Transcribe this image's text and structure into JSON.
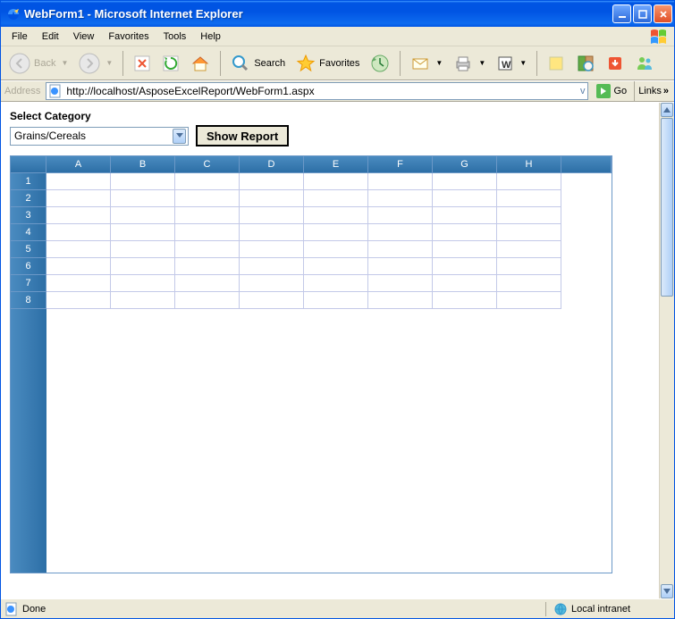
{
  "title": "WebForm1 - Microsoft Internet Explorer",
  "menu": [
    "File",
    "Edit",
    "View",
    "Favorites",
    "Tools",
    "Help"
  ],
  "toolbar": {
    "back": "Back",
    "search": "Search",
    "favorites": "Favorites"
  },
  "addressbar": {
    "label": "Address",
    "url": "http://localhost/AsposeExcelReport/WebForm1.aspx",
    "go": "Go",
    "links": "Links"
  },
  "page": {
    "select_label": "Select Category",
    "dropdown_value": "Grains/Cereals",
    "button_label": "Show Report"
  },
  "sheet": {
    "columns": [
      "A",
      "B",
      "C",
      "D",
      "E",
      "F",
      "G",
      "H"
    ],
    "rows": [
      "1",
      "2",
      "3",
      "4",
      "5",
      "6",
      "7",
      "8"
    ]
  },
  "status": {
    "text": "Done",
    "zone": "Local intranet"
  }
}
